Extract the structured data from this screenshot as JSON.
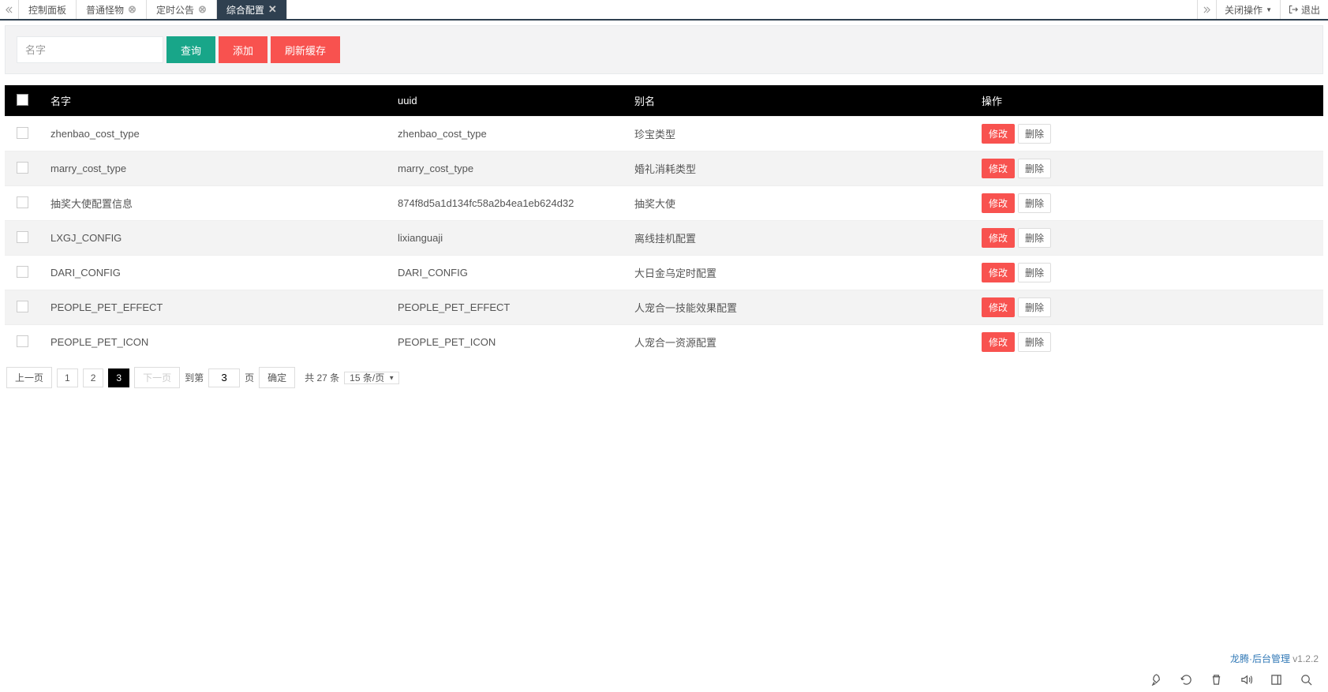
{
  "tabs": [
    {
      "label": "控制面板",
      "closable": false,
      "active": false
    },
    {
      "label": "普通怪物",
      "closable": true,
      "active": false
    },
    {
      "label": "定时公告",
      "closable": true,
      "active": false
    },
    {
      "label": "综合配置",
      "closable": true,
      "active": true
    }
  ],
  "topRight": {
    "closeOps": "关闭操作",
    "exit": "退出"
  },
  "search": {
    "placeholder": "名字",
    "query": "查询",
    "add": "添加",
    "refresh": "刷新缓存"
  },
  "table": {
    "headers": {
      "name": "名字",
      "uuid": "uuid",
      "alias": "别名",
      "op": "操作"
    },
    "editLabel": "修改",
    "deleteLabel": "删除",
    "rows": [
      {
        "name": "zhenbao_cost_type",
        "uuid": "zhenbao_cost_type",
        "alias": "珍宝类型"
      },
      {
        "name": "marry_cost_type",
        "uuid": "marry_cost_type",
        "alias": "婚礼消耗类型"
      },
      {
        "name": "抽奖大使配置信息",
        "uuid": "874f8d5a1d134fc58a2b4ea1eb624d32",
        "alias": "抽奖大使"
      },
      {
        "name": "LXGJ_CONFIG",
        "uuid": "lixianguaji",
        "alias": "离线挂机配置"
      },
      {
        "name": "DARI_CONFIG",
        "uuid": "DARI_CONFIG",
        "alias": "大日金乌定时配置"
      },
      {
        "name": "PEOPLE_PET_EFFECT",
        "uuid": "PEOPLE_PET_EFFECT",
        "alias": "人宠合一技能效果配置"
      },
      {
        "name": "PEOPLE_PET_ICON",
        "uuid": "PEOPLE_PET_ICON",
        "alias": "人宠合一资源配置"
      }
    ]
  },
  "pager": {
    "prev": "上一页",
    "next": "下一页",
    "pages": [
      "1",
      "2",
      "3"
    ],
    "current": "3",
    "gotoLabel": "到第",
    "gotoValue": "3",
    "pageUnit": "页",
    "confirm": "确定",
    "total": "共 27 条",
    "pageSize": "15 条/页"
  },
  "footer": {
    "product": "龙腾·后台管理",
    "version": "v1.2.2"
  }
}
